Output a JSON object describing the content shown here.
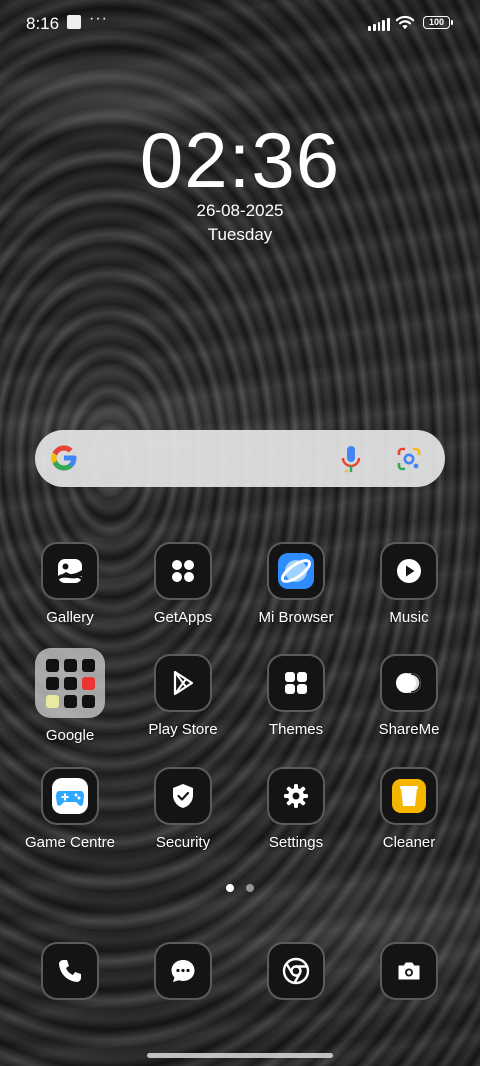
{
  "status_bar": {
    "time": "8:16",
    "dots": "···",
    "battery": "100"
  },
  "lockscreen_clock": {
    "time": "02:36",
    "date": "26-08-2025",
    "weekday": "Tuesday"
  },
  "search_bar": {
    "logo": "google-g-icon",
    "voice_icon": "microphone-icon",
    "lens_icon": "google-lens-icon"
  },
  "apps": [
    {
      "label": "Gallery",
      "icon": "gallery-icon"
    },
    {
      "label": "GetApps",
      "icon": "getapps-icon"
    },
    {
      "label": "Mi Browser",
      "icon": "mi-browser-icon"
    },
    {
      "label": "Music",
      "icon": "music-icon"
    },
    {
      "label": "Google",
      "icon": "google-folder-icon"
    },
    {
      "label": "Play Store",
      "icon": "play-store-icon"
    },
    {
      "label": "Themes",
      "icon": "themes-icon"
    },
    {
      "label": "ShareMe",
      "icon": "shareme-icon"
    },
    {
      "label": "Game Centre",
      "icon": "game-centre-icon"
    },
    {
      "label": "Security",
      "icon": "security-icon"
    },
    {
      "label": "Settings",
      "icon": "settings-icon"
    },
    {
      "label": "Cleaner",
      "icon": "cleaner-icon"
    }
  ],
  "dock": [
    {
      "icon": "phone-icon"
    },
    {
      "icon": "messages-icon"
    },
    {
      "icon": "chrome-icon"
    },
    {
      "icon": "camera-icon"
    }
  ],
  "page_indicator": {
    "pages": 2,
    "active": 1
  },
  "colors": {
    "accent_blue": "#3d9bff",
    "cleaner_yellow": "#f5b600",
    "google_blue": "#4285F4",
    "google_red": "#EA4335",
    "google_yellow": "#FBBC05",
    "google_green": "#34A853"
  }
}
